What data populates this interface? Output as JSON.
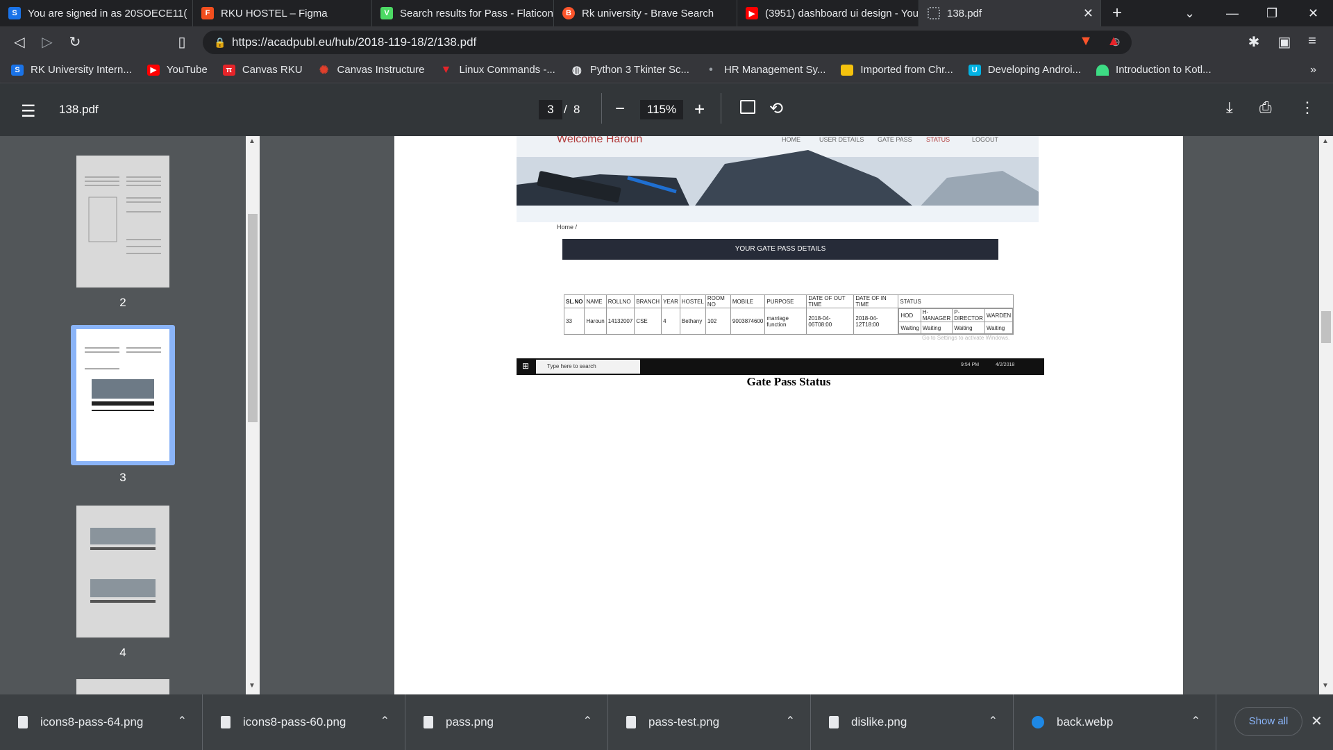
{
  "tabs": [
    {
      "title": "You are signed in as 20SOECE11(",
      "icon": "S",
      "color": "#1a73e8"
    },
    {
      "title": "RKU HOSTEL – Figma",
      "icon": "F",
      "color": "#f24e1e"
    },
    {
      "title": "Search results for Pass - Flaticon",
      "icon": "V",
      "color": "#4cd964"
    },
    {
      "title": "Rk university - Brave Search",
      "icon": "B",
      "color": "#fb542b"
    },
    {
      "title": "(3951) dashboard ui design - You",
      "icon": "▶",
      "color": "#ff0000"
    },
    {
      "title": "138.pdf",
      "icon": "",
      "color": "#5f6368"
    }
  ],
  "address": {
    "url": "https://acadpubl.eu/hub/2018-119-18/2/138.pdf"
  },
  "bookmarks": [
    {
      "label": "RK University Intern...",
      "icon": "S",
      "color": "#1a73e8"
    },
    {
      "label": "YouTube",
      "icon": "▶",
      "color": "#ff0000"
    },
    {
      "label": "Canvas RKU",
      "icon": "π",
      "color": "#e62429"
    },
    {
      "label": "Canvas Instructure",
      "icon": "✺",
      "color": "#e13f2b"
    },
    {
      "label": "Linux Commands -...",
      "icon": "▼",
      "color": "#e62429"
    },
    {
      "label": "Python 3 Tkinter Sc...",
      "icon": "◍",
      "color": "#5f6368"
    },
    {
      "label": "HR Management Sy...",
      "icon": "•",
      "color": "#35363a"
    },
    {
      "label": "Imported from Chr...",
      "icon": "",
      "color": "#f4c20d"
    },
    {
      "label": "Developing Androi...",
      "icon": "U",
      "color": "#02b3e4"
    },
    {
      "label": "Introduction to Kotl...",
      "icon": "",
      "color": "#3ddc84"
    }
  ],
  "pdf": {
    "filename": "138.pdf",
    "current_page": "3",
    "separator": "/",
    "total_pages": "8",
    "zoom": "115%"
  },
  "thumbnails": [
    {
      "label": "2"
    },
    {
      "label": "3"
    },
    {
      "label": "4"
    }
  ],
  "page_content": {
    "welcome": "Welcome Haroun",
    "nav": [
      "HOME",
      "USER DETAILS",
      "GATE PASS",
      "STATUS",
      "LOGOUT"
    ],
    "breadcrumb": "Home /",
    "banner": "YOUR GATE PASS DETAILS",
    "table_headers": [
      "SL.NO",
      "NAME",
      "ROLLNO",
      "BRANCH",
      "YEAR",
      "HOSTEL",
      "ROOM NO",
      "MOBILE",
      "PURPOSE",
      "DATE OF OUT TIME",
      "DATE OF IN TIME",
      "STATUS"
    ],
    "row": [
      "33",
      "Haroun",
      "14132007",
      "CSE",
      "4",
      "Bethany",
      "102",
      "9003874600",
      "marriage function",
      "2018-04-06T08:00",
      "2018-04-12T18:00"
    ],
    "status_headers": [
      "HOD",
      "H-MANAGER",
      "P-DIRECTOR",
      "WARDEN"
    ],
    "status_values": [
      "Waiting",
      "Waiting",
      "Waiting",
      "Waiting"
    ],
    "activate_windows": "Go to Settings to activate Windows.",
    "taskbar_search": "Type here to search",
    "taskbar_time": "9:54 PM",
    "taskbar_date": "4/2/2018",
    "caption": "Gate Pass Status"
  },
  "downloads": [
    {
      "name": "icons8-pass-64.png"
    },
    {
      "name": "icons8-pass-60.png"
    },
    {
      "name": "pass.png"
    },
    {
      "name": "pass-test.png"
    },
    {
      "name": "dislike.png"
    },
    {
      "name": "back.webp"
    }
  ],
  "downloads_show_all": "Show all"
}
